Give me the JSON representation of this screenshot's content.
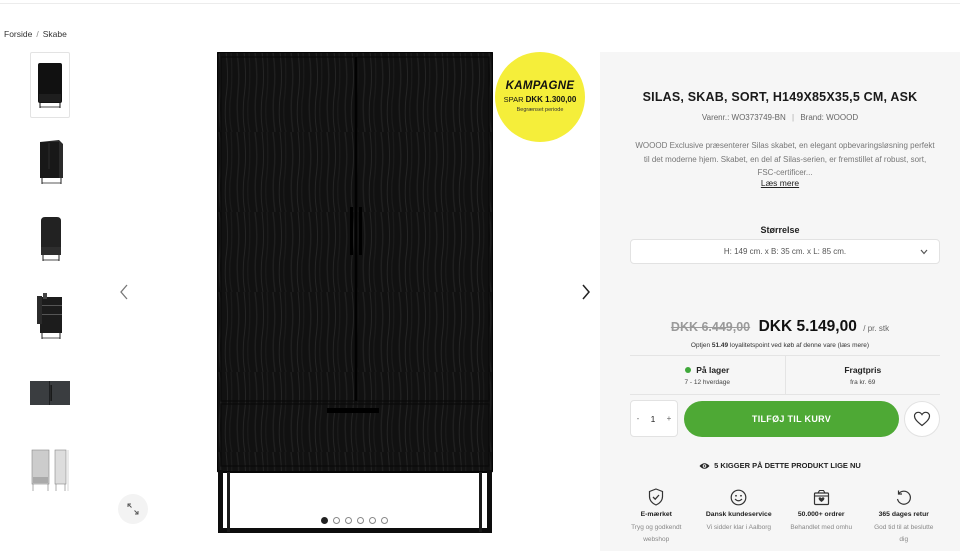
{
  "breadcrumb": {
    "home": "Forside",
    "separator": "/",
    "category": "Skabe"
  },
  "gallery": {
    "thumbnail_names": [
      "front-closed",
      "angle-view",
      "side-view",
      "open-view",
      "detail-handle",
      "dimensions-drawing"
    ],
    "dot_count": 6,
    "active_index": 0
  },
  "campaign": {
    "title": "KAMPAGNE",
    "save_prefix": "SPAR",
    "save_amount": "DKK 1.300,00",
    "note": "Begrænset periode",
    "color": "#f5ee3a"
  },
  "product": {
    "title": "SILAS, SKAB, SORT, H149X85X35,5 CM, ASK",
    "sku_label": "Varenr.: WO373749-BN",
    "meta_separator": "|",
    "brand_label": "Brand: WOOOD",
    "description_line1": "WOOOD Exclusive præsenterer Silas skabet, en elegant opbevaringsløsning perfekt",
    "description_line2": "til det moderne hjem. Skabet, en del af Silas-serien, er fremstillet af robust, sort,",
    "description_line3": "FSC-certificer...",
    "read_more": "Læs mere"
  },
  "size": {
    "label": "Størrelse",
    "selected": "H: 149 cm. x B: 35 cm. x L: 85 cm."
  },
  "price": {
    "old": "DKK 6.449,00",
    "new": "DKK 5.149,00",
    "per": "/ pr. stk",
    "loyalty_prefix": "Optjen",
    "loyalty_points": "51.49",
    "loyalty_suffix": "loyalitetspoint ved køb af denne vare (læs mere)"
  },
  "stock": {
    "title": "På lager",
    "subtitle": "7 - 12 hverdage",
    "status_color": "#3fa83a"
  },
  "shipping": {
    "title": "Fragtpris",
    "subtitle": "fra kr. 69"
  },
  "cart": {
    "minus": "-",
    "quantity": "1",
    "plus": "+",
    "add_label": "TILFØJ TIL KURV",
    "button_color": "#4ea935"
  },
  "viewers": {
    "text": "5 KIGGER PÅ DETTE PRODUKT LIGE NU"
  },
  "usps": [
    {
      "icon": "shield-check-icon",
      "title": "E-mærket",
      "line1": "Tryg og godkendt",
      "line2": "webshop"
    },
    {
      "icon": "smiley-icon",
      "title": "Dansk kundeservice",
      "line1": "Vi sidder klar i Aalborg",
      "line2": ""
    },
    {
      "icon": "box-heart-icon",
      "title": "50.000+ ordrer",
      "line1": "Behandlet med omhu",
      "line2": ""
    },
    {
      "icon": "return-arrow-icon",
      "title": "365 dages retur",
      "line1": "God tid til at beslutte",
      "line2": "dig"
    }
  ]
}
